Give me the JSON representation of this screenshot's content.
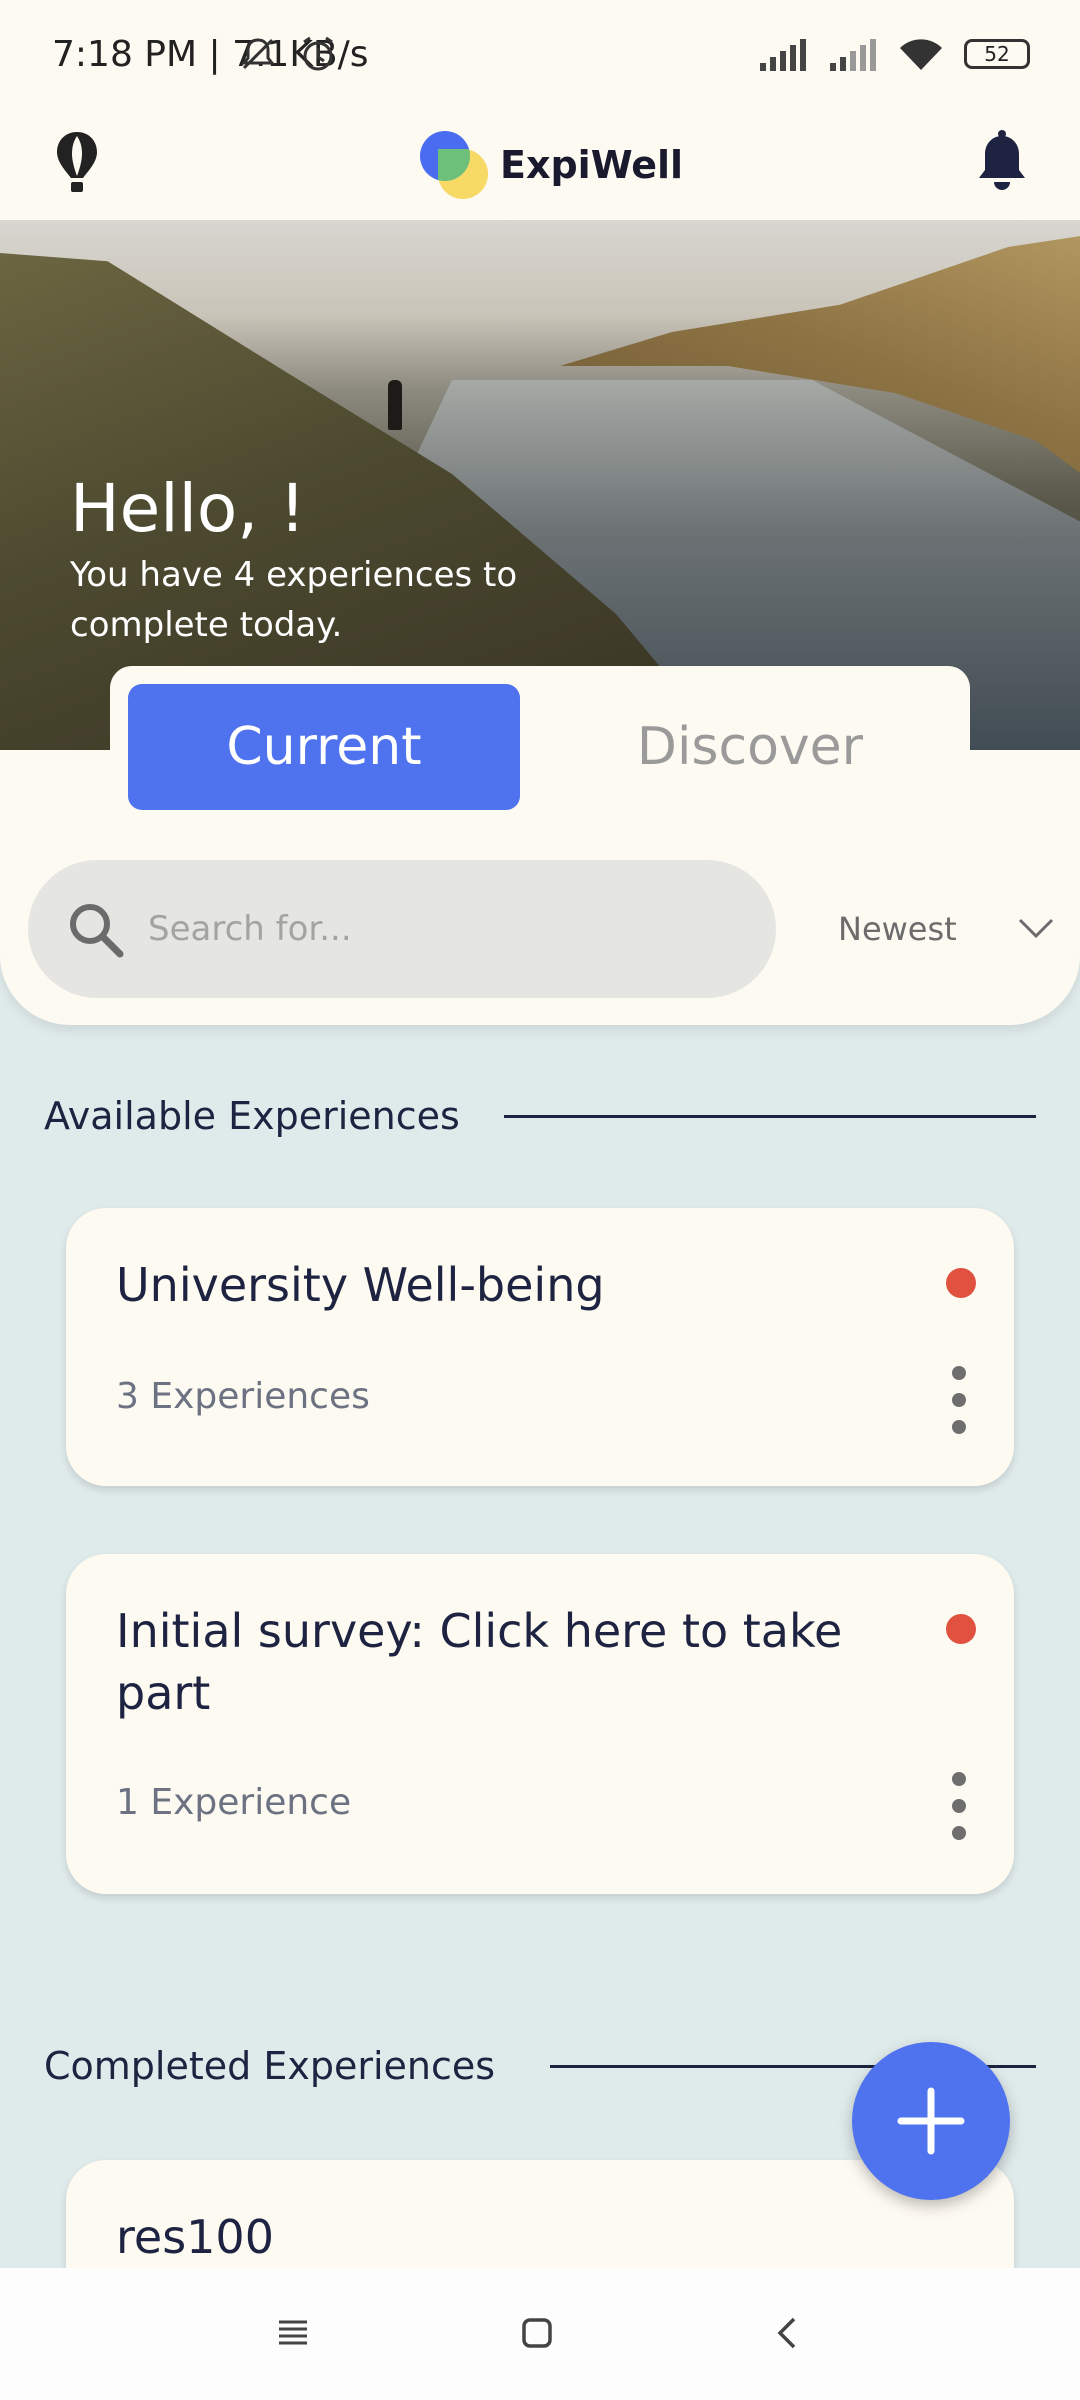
{
  "status_bar": {
    "time": "7:18 PM | 7.1KB/s",
    "battery": "52"
  },
  "header": {
    "app_name": "ExpiWell"
  },
  "hero": {
    "greeting": "Hello, !",
    "subtitle": "You have 4 experiences to complete today."
  },
  "tabs": {
    "current": "Current",
    "discover": "Discover",
    "active": "Current"
  },
  "search": {
    "placeholder": "Search for...",
    "value": ""
  },
  "sort": {
    "selected": "Newest"
  },
  "sections": {
    "available": "Available Experiences",
    "completed": "Completed Experiences"
  },
  "available_items": [
    {
      "title": "University Well-being",
      "count": "3 Experiences"
    },
    {
      "title": "Initial survey: Click here to take part",
      "count": "1 Experience"
    }
  ],
  "completed_items": [
    {
      "title": "res100"
    }
  ],
  "colors": {
    "accent": "#4f72ef",
    "unread_dot": "#e0513f",
    "background": "#dfeaea",
    "card": "#fdfaf2"
  }
}
